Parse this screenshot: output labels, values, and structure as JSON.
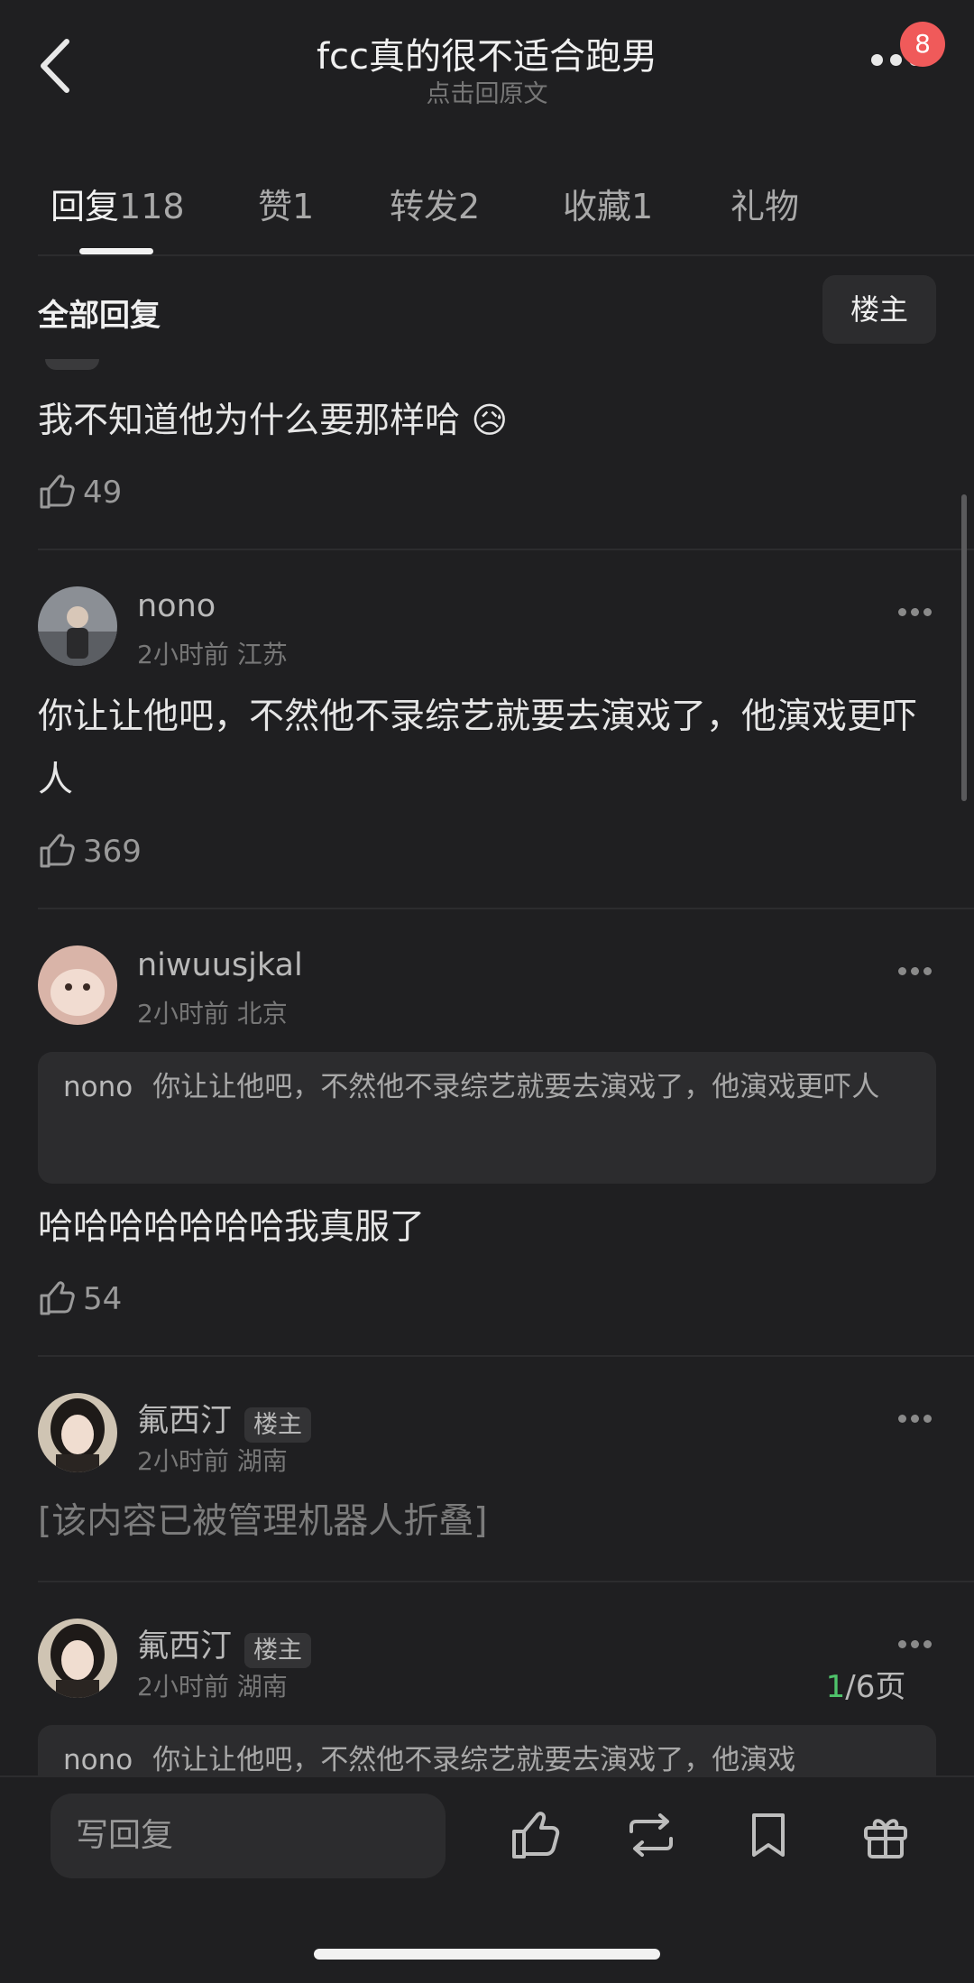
{
  "header": {
    "title": "fcc真的很不适合跑男",
    "subtitle": "点击回原文",
    "notification_count": "8"
  },
  "tabs": [
    {
      "label": "回复",
      "count": "118"
    },
    {
      "label": "赞",
      "count": "1"
    },
    {
      "label": "转发",
      "count": "2"
    },
    {
      "label": "收藏",
      "count": "1"
    },
    {
      "label": "礼物",
      "count": ""
    }
  ],
  "section": {
    "title": "全部回复",
    "owner_filter": "楼主"
  },
  "comments": [
    {
      "text": "我不知道他为什么要那样哈 😥",
      "likes": "49"
    },
    {
      "user": "nono",
      "time": "2小时前",
      "location": "江苏",
      "text": "你让让他吧，不然他不录综艺就要去演戏了，他演戏更吓人",
      "likes": "369"
    },
    {
      "user": "niwuusjkal",
      "time": "2小时前",
      "location": "北京",
      "quote_user": "nono",
      "quote_text": "你让让他吧，不然他不录综艺就要去演戏了，他演戏更吓人",
      "text": "哈哈哈哈哈哈哈我真服了",
      "likes": "54"
    },
    {
      "user": "氟西汀",
      "tag": "楼主",
      "time": "2小时前",
      "location": "湖南",
      "text": "[该内容已被管理机器人折叠]"
    },
    {
      "user": "氟西汀",
      "tag": "楼主",
      "time": "2小时前",
      "location": "湖南",
      "quote_user": "nono",
      "quote_text": "你让让他吧，不然他不录综艺就要去演戏了，他演戏"
    }
  ],
  "pager": {
    "current": "1",
    "total": "/6页"
  },
  "bottom_bar": {
    "reply_placeholder": "写回复"
  }
}
